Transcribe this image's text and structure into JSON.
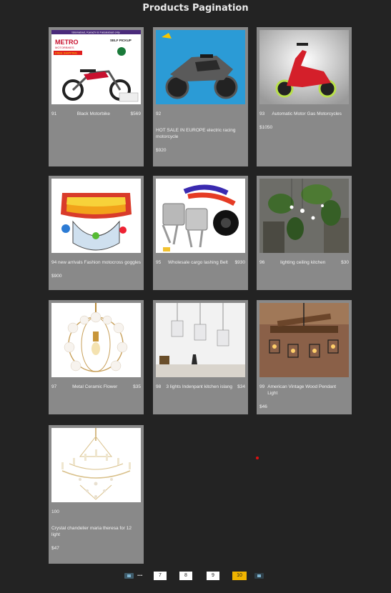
{
  "page": {
    "title": "Products Pagination"
  },
  "products": [
    {
      "id": "91",
      "name": "Black Motorbike",
      "price": "$569"
    },
    {
      "id": "92",
      "name": "HOT SALE IN EUROPE electric racing motorcycle",
      "price": "$920"
    },
    {
      "id": "93",
      "name": "Automatic Motor Gas Motorcycles",
      "price": "$1050"
    },
    {
      "id": "94",
      "name": "94 new arrivals Fashion motocross goggles",
      "price": "$900"
    },
    {
      "id": "95",
      "name": "Wholesale cargo lashing Belt",
      "price": "$930"
    },
    {
      "id": "96",
      "name": "lighting ceiling kitchen",
      "price": "$30"
    },
    {
      "id": "97",
      "name": "Metal Ceramic Flower",
      "price": "$35"
    },
    {
      "id": "98",
      "name": "3 lights Indenpant kitchen islang",
      "price": "$34"
    },
    {
      "id": "99",
      "name": "American Vintage Wood Pendant Light",
      "price": "$46"
    },
    {
      "id": "100",
      "name": "Crystal chandelier maria theresa for 12 light",
      "price": "$47"
    }
  ],
  "pagination": {
    "ellipsis": "...",
    "pages": [
      "7",
      "8",
      "9",
      "10"
    ],
    "active": "10"
  },
  "banner": {
    "top_line": "Islamabad, Karachi & Faisalabad only",
    "brand": "METRO",
    "brand_sub": "MOTORBIKES",
    "tag": "SELF PICKUP",
    "badge": "FREE SHIPPING"
  },
  "icons": [
    "prev-page-icon",
    "next-page-icon"
  ]
}
